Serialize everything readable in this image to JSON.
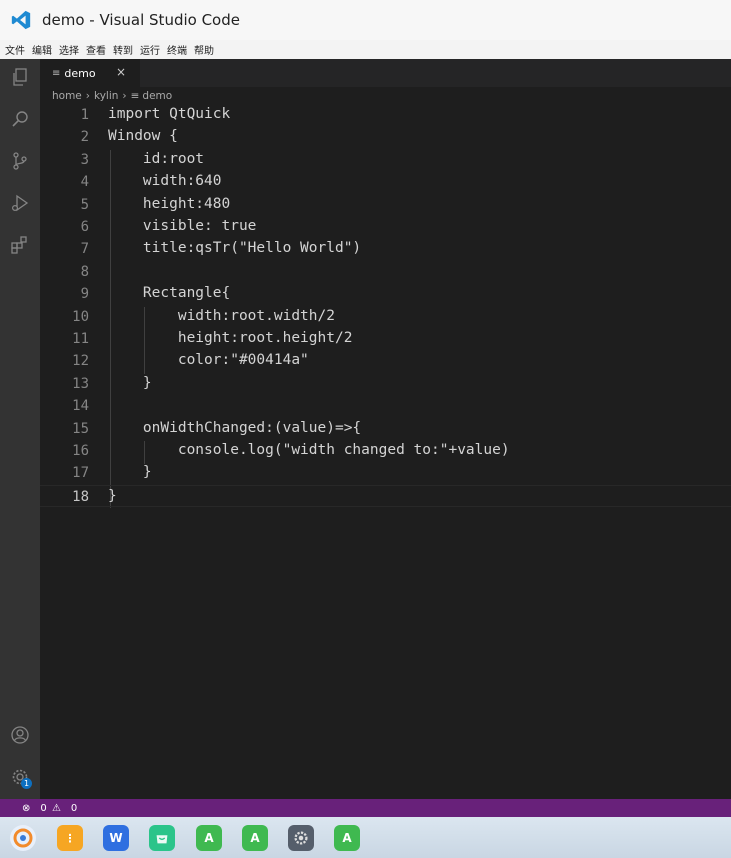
{
  "window": {
    "title": "demo - Visual Studio Code"
  },
  "menu": [
    "文件",
    "编辑",
    "选择",
    "查看",
    "转到",
    "运行",
    "终端",
    "帮助"
  ],
  "activity_bar": {
    "icons": [
      "explorer-icon",
      "search-icon",
      "source-control-icon",
      "run-debug-icon",
      "extensions-icon",
      "account-icon",
      "settings-gear-icon"
    ],
    "settings_badge": "1"
  },
  "tab": {
    "icon": "≡",
    "label": "demo",
    "close": "×"
  },
  "breadcrumb": {
    "items": [
      "home",
      "kylin",
      "demo"
    ],
    "file_icon": "≡"
  },
  "editor": {
    "lines": [
      {
        "num": "1",
        "text": "import QtQuick"
      },
      {
        "num": "2",
        "text": "Window {"
      },
      {
        "num": "3",
        "text": "    id:root"
      },
      {
        "num": "4",
        "text": "    width:640"
      },
      {
        "num": "5",
        "text": "    height:480"
      },
      {
        "num": "6",
        "text": "    visible: true"
      },
      {
        "num": "7",
        "text": "    title:qsTr(\"Hello World\")"
      },
      {
        "num": "8",
        "text": ""
      },
      {
        "num": "9",
        "text": "    Rectangle{"
      },
      {
        "num": "10",
        "text": "        width:root.width/2"
      },
      {
        "num": "11",
        "text": "        height:root.height/2"
      },
      {
        "num": "12",
        "text": "        color:\"#00414a\""
      },
      {
        "num": "13",
        "text": "    }"
      },
      {
        "num": "14",
        "text": ""
      },
      {
        "num": "15",
        "text": "    onWidthChanged:(value)=>{"
      },
      {
        "num": "16",
        "text": "        console.log(\"width changed to:\"+value)"
      },
      {
        "num": "17",
        "text": "    }"
      },
      {
        "num": "18",
        "text": "}"
      }
    ],
    "current_line": "18"
  },
  "status": {
    "errors": "0",
    "warnings": "0"
  },
  "taskbar": {
    "apps": [
      {
        "name": "start-menu-icon",
        "color": "#e8f0fb"
      },
      {
        "name": "file-manager-icon",
        "color": "#f6a623"
      },
      {
        "name": "wps-icon",
        "color": "#2f6fe0",
        "glyph": "W"
      },
      {
        "name": "app-store-icon",
        "color": "#2bc48a"
      },
      {
        "name": "android-app-icon-1",
        "color": "#3fb950",
        "glyph": "A"
      },
      {
        "name": "android-app-icon-2",
        "color": "#3fb950",
        "glyph": "A"
      },
      {
        "name": "settings-app-icon",
        "color": "#555e6b"
      },
      {
        "name": "android-app-icon-3",
        "color": "#3fb950",
        "glyph": "A"
      }
    ]
  }
}
